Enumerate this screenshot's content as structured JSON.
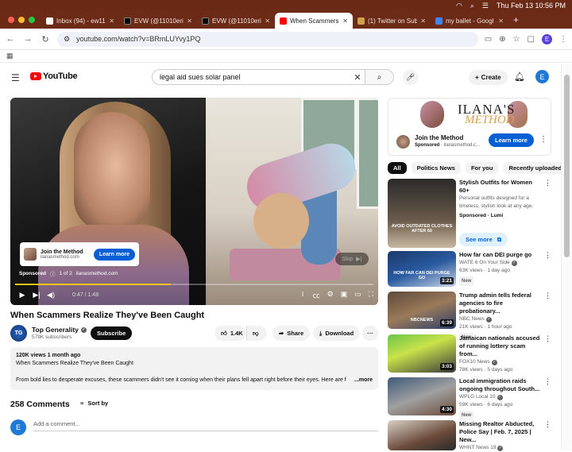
{
  "menubar": {
    "datetime": "Thu Feb 13  10:56 PM"
  },
  "tabs": [
    {
      "title": "Inbox (94) - ew11(",
      "color": "#ffffff",
      "icon": "gmail-icon",
      "active": false
    },
    {
      "title": "EVW (@11010eri",
      "color": "#000000",
      "icon": "x-icon",
      "active": false
    },
    {
      "title": "EVW (@11010eri",
      "color": "#000000",
      "icon": "x-icon",
      "active": false
    },
    {
      "title": "When Scammers R",
      "color": "#ff0000",
      "icon": "youtube-icon",
      "active": true
    },
    {
      "title": "(1) Twitter on Sub",
      "color": "#cfa14a",
      "icon": "substack-icon",
      "active": false
    },
    {
      "title": "my ballet - Googl",
      "color": "#4285f4",
      "icon": "google-icon",
      "active": false
    }
  ],
  "address": {
    "url": "youtube.com/watch?v=BRmLUYvy1PQ",
    "profile": "E"
  },
  "youtube": {
    "logo": "YouTube",
    "search_query": "legal aid sues solar panel",
    "create_label": "Create",
    "avatar": "E"
  },
  "player": {
    "ad_title": "Join the Method",
    "ad_domain": "ilanasmethod.com",
    "ad_cta": "Learn more",
    "sponsored": "Sponsored",
    "ad_count": "1 of 2",
    "ad_site": "ilanasmethod.com",
    "skip": "Skip",
    "time": "0:47 / 1:48",
    "progress_fraction": 0.435
  },
  "video": {
    "title": "When Scammers Realize They've Been Caught",
    "channel": "Top Generality",
    "subscribers": "579K subscribers",
    "subscribe_label": "Subscribe",
    "likes": "1.4K",
    "share_label": "Share",
    "download_label": "Download",
    "meta": "120K views  1 month ago",
    "desc_line1": "When Scammers Realize They've Been Caught",
    "desc_line2": "From bold lies to desperate excuses, these scammers didn't see it coming when their plans fell apart right before their eyes. Here are f",
    "more_label": "...more"
  },
  "comments": {
    "count_label": "258 Comments",
    "sort_label": "Sort by",
    "placeholder": "Add a comment...",
    "avatar": "E"
  },
  "sidebar": {
    "ad": {
      "banner_top": "ILANA'S",
      "banner_bottom": "METHOD",
      "name": "Join the Method",
      "sponsored": "Sponsored",
      "domain": "ilanasmethod.c...",
      "cta": "Learn more"
    },
    "chips": [
      "All",
      "Politics News",
      "For you",
      "Recently uploaded"
    ],
    "items": [
      {
        "title": "Stylish Outfits for Women 60+",
        "channel": "Personal outfits designed for a timeless, stylish look at any age.",
        "views": "Sponsored · Lumi",
        "thumb_text": "AVOID OUTDATED CLOTHES AFTER 60",
        "duration": "",
        "badge": ""
      },
      {
        "title": "How far can DEI purge go",
        "channel": "WATE 6 On Your Side",
        "views": "63K views · 1 day ago",
        "duration": "3:21",
        "badge": "New",
        "thumb_text": "HOW FAR CAN DEI PURGE GO"
      },
      {
        "title": "Trump admin tells federal agencies to fire probationary...",
        "channel": "NBC News",
        "views": "21K views · 1 hour ago",
        "duration": "6:39",
        "badge": "New",
        "thumb_text": "NBCNEWS"
      },
      {
        "title": "Jamaican nationals accused of running lottery scam from...",
        "channel": "FOX10 News",
        "views": "78K views · 5 days ago",
        "duration": "3:03",
        "badge": "",
        "thumb_text": ""
      },
      {
        "title": "Local immigration raids ongoing throughout South...",
        "channel": "WPLG Local 10",
        "views": "59K views · 6 days ago",
        "duration": "4:30",
        "badge": "New",
        "thumb_text": ""
      },
      {
        "title": "Missing Realtor Abducted, Police Say | Feb. 7, 2025 | New...",
        "channel": "WHNT News 19",
        "views": "",
        "duration": "",
        "badge": "",
        "thumb_text": ""
      }
    ],
    "see_more": "See more"
  }
}
